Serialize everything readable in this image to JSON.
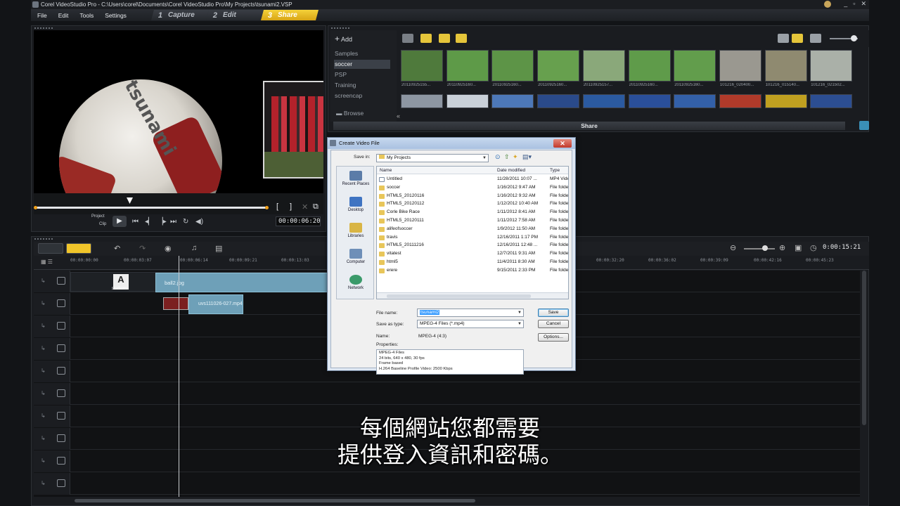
{
  "window": {
    "title": "Corel VideoStudio Pro - C:\\Users\\corel\\Documents\\Corel VideoStudio Pro\\My Projects\\tsunami2.VSP",
    "controls": [
      "_",
      "▫",
      "✕"
    ]
  },
  "menu": [
    "File",
    "Edit",
    "Tools",
    "Settings"
  ],
  "steps": [
    {
      "num": "1",
      "label": "Capture"
    },
    {
      "num": "2",
      "label": "Edit"
    },
    {
      "num": "3",
      "label": "Share"
    }
  ],
  "preview": {
    "ball_text": "tsunami",
    "mode_project": "Project",
    "mode_clip": "Clip",
    "timecode": "00:00:06:20",
    "bracket_in": "[",
    "bracket_out": "]"
  },
  "library": {
    "add_label": "Add",
    "folders": [
      "Samples",
      "soccer",
      "PSP",
      "Training",
      "screencap"
    ],
    "selected_folder": "soccer",
    "browse_label": "Browse",
    "thumb_captions": [
      "20110925155...",
      "20110925160...",
      "20110925160...",
      "20110925160...",
      "20110925157...",
      "20110925160...",
      "20110925160...",
      "101216_020400...",
      "101216_015140...",
      "101216_021502..."
    ],
    "share_label": "Share",
    "collapse": "«"
  },
  "timeline": {
    "ruler_ticks": [
      "00:00:00:00",
      "00:00:03:07",
      "00:00:06:14",
      "00:00:09:21",
      "00:00:13:03",
      "00:00:32:20",
      "00:00:36:02",
      "00:00:39:09",
      "00:00:42:16",
      "00:00:45:23"
    ],
    "clip_title": "ball2.jpg",
    "clip_overlay": "uvs111026-027.mp4",
    "clip_text": "stadium",
    "project_time": "0:00:15:21"
  },
  "dialog": {
    "title": "Create Video File",
    "save_in_label": "Save in:",
    "save_in_value": "My Projects",
    "places": [
      "Recent Places",
      "Desktop",
      "Libraries",
      "Computer",
      "Network"
    ],
    "columns": [
      "Name",
      "Date modified",
      "Type"
    ],
    "files": [
      {
        "name": "Untitled",
        "date": "11/28/2011 10:07 ...",
        "type": "MP4 Video",
        "doc": true
      },
      {
        "name": "soccer",
        "date": "1/16/2012 9:47 AM",
        "type": "File folder"
      },
      {
        "name": "HTML5_20120116",
        "date": "1/16/2012 9:32 AM",
        "type": "File folder"
      },
      {
        "name": "HTML5_20120112",
        "date": "1/12/2012 10:40 AM",
        "type": "File folder"
      },
      {
        "name": "Corle Bike Race",
        "date": "1/11/2012 8:41 AM",
        "type": "File folder"
      },
      {
        "name": "HTML5_20120111",
        "date": "1/11/2012 7:58 AM",
        "type": "File folder"
      },
      {
        "name": "alifeofsoccer",
        "date": "1/9/2012 11:50 AM",
        "type": "File folder"
      },
      {
        "name": "travis",
        "date": "12/16/2011 1:17 PM",
        "type": "File folder"
      },
      {
        "name": "HTML5_20111216",
        "date": "12/16/2011 12:48 ...",
        "type": "File folder"
      },
      {
        "name": "vitatest",
        "date": "12/7/2011 9:31 AM",
        "type": "File folder"
      },
      {
        "name": "html5",
        "date": "11/4/2011 8:30 AM",
        "type": "File folder"
      },
      {
        "name": "erere",
        "date": "9/15/2011 2:33 PM",
        "type": "File folder"
      }
    ],
    "file_name_label": "File name:",
    "file_name_value": "tsunami2",
    "save_as_label": "Save as type:",
    "save_as_value": "MPEG-4 Files (*.mp4)",
    "name_label": "Name:",
    "name_value": "MPEG-4 (4:3)",
    "properties_label": "Properties:",
    "properties": [
      "MPEG-4 Files",
      "24 bits, 640 x 480, 30 fps",
      "Frame based",
      "H.264 Baseline Profile Video: 2500 Kbps"
    ],
    "save_btn": "Save",
    "cancel_btn": "Cancel",
    "options_btn": "Options..."
  },
  "subtitles": [
    "每個網站您都需要",
    "提供登入資訊和密碼。"
  ]
}
